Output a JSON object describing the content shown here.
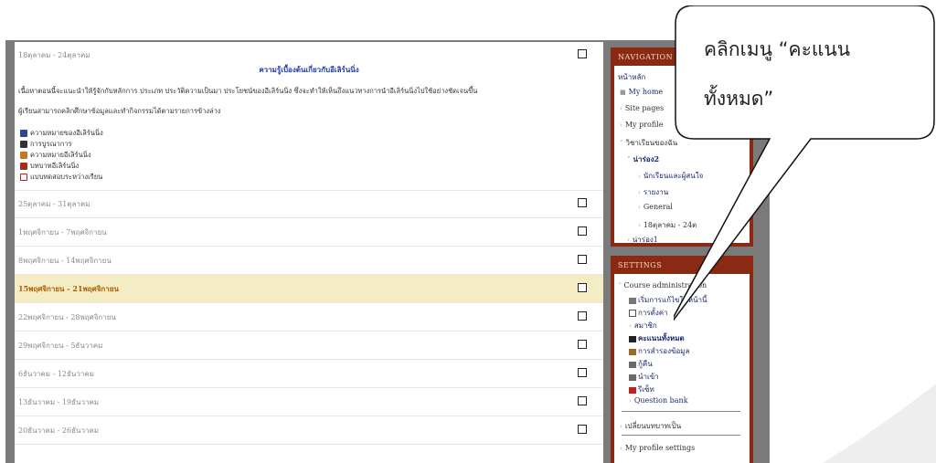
{
  "sections": {
    "first": {
      "date_range": "18ตุลาคม - 24ตุลาคม",
      "title": "ความรู้เบื้องต้นเกี่ยวกับอีเลิร์นนิ่ง",
      "intro": "เนื้อหาตอนนี้จะแนะนำให้รู้จักกับหลักการ ประเภท ประวัติความเป็นมา ประโยชน์ของอีเลิร์นนิ่ง ซึ่งจะทำให้เห็นถึงแนวทางการนำอีเลิร์นนิ่งไปใช้อย่างชัดเจนขึ้น",
      "instruction": "ผู้เรียนสามารถคลิกศึกษาข้อมูลและทำกิจกรรมได้ตามรายการข้างล่าง",
      "resources": [
        {
          "label": "ความหมายของอีเลิร์นนิ่ง",
          "icon": "document-icon",
          "color": "#2b4a8a"
        },
        {
          "label": "การบูรณาการ",
          "icon": "book-icon",
          "color": "#333333"
        },
        {
          "label": "ความหมายอีเลิร์นนิ่ง",
          "icon": "forum-icon",
          "color": "#c07a20"
        },
        {
          "label": "บทบาทอีเลิร์นนิ่ง",
          "icon": "people-icon",
          "color": "#a0301a"
        },
        {
          "label": "แบบทดสอบระหว่างเรียน",
          "icon": "quiz-icon",
          "color": "#b02020"
        }
      ]
    },
    "rows": [
      {
        "label": "25ตุลาคม - 31ตุลาคม",
        "current": false
      },
      {
        "label": "1พฤศจิกายน - 7พฤศจิกายน",
        "current": false
      },
      {
        "label": "8พฤศจิกายน - 14พฤศจิกายน",
        "current": false
      },
      {
        "label": "15พฤศจิกายน - 21พฤศจิกายน",
        "current": true
      },
      {
        "label": "22พฤศจิกายน - 28พฤศจิกายน",
        "current": false
      },
      {
        "label": "29พฤศจิกายน - 5ธันวาคม",
        "current": false
      },
      {
        "label": "6ธันวาคม - 12ธันวาคม",
        "current": false
      },
      {
        "label": "13ธันวาคม - 19ธันวาคม",
        "current": false
      },
      {
        "label": "20ธันวาคม - 26ธันวาคม",
        "current": false
      }
    ]
  },
  "navigation": {
    "header": "NAVIGATION",
    "home": "หน้าหลัก",
    "my_home": "My home",
    "site_pages": "Site pages",
    "my_profile": "My profile",
    "my_courses": "วิชาเรียนของฉัน",
    "course_short": "น่าร่อง2",
    "participants": "นักเรียนและผู้สนใจ",
    "reports": "รายงาน",
    "general": "General",
    "week": "18ตุลาคม - 24ต",
    "course2": "น่าร่อง1"
  },
  "settings": {
    "header": "SETTINGS",
    "course_admin": "Course administration",
    "turn_editing": "เริ่มการแก้ไขในหน้านี้",
    "edit_settings": "การตั้งค่า",
    "users": "สมาชิก",
    "grades": "คะแนนทั้งหมด",
    "backup": "การสำรองข้อมูล",
    "restore": "กู้คืน",
    "import": "นำเข้า",
    "reset": "รีเซ็ท",
    "question_bank": "Question bank",
    "switch_role": "เปลี่ยนบทบาทเป็น",
    "profile_settings": "My profile settings"
  },
  "callout": {
    "line1": "คลิกเมนู “คะแนน",
    "line2": "ทั้งหมด”"
  }
}
